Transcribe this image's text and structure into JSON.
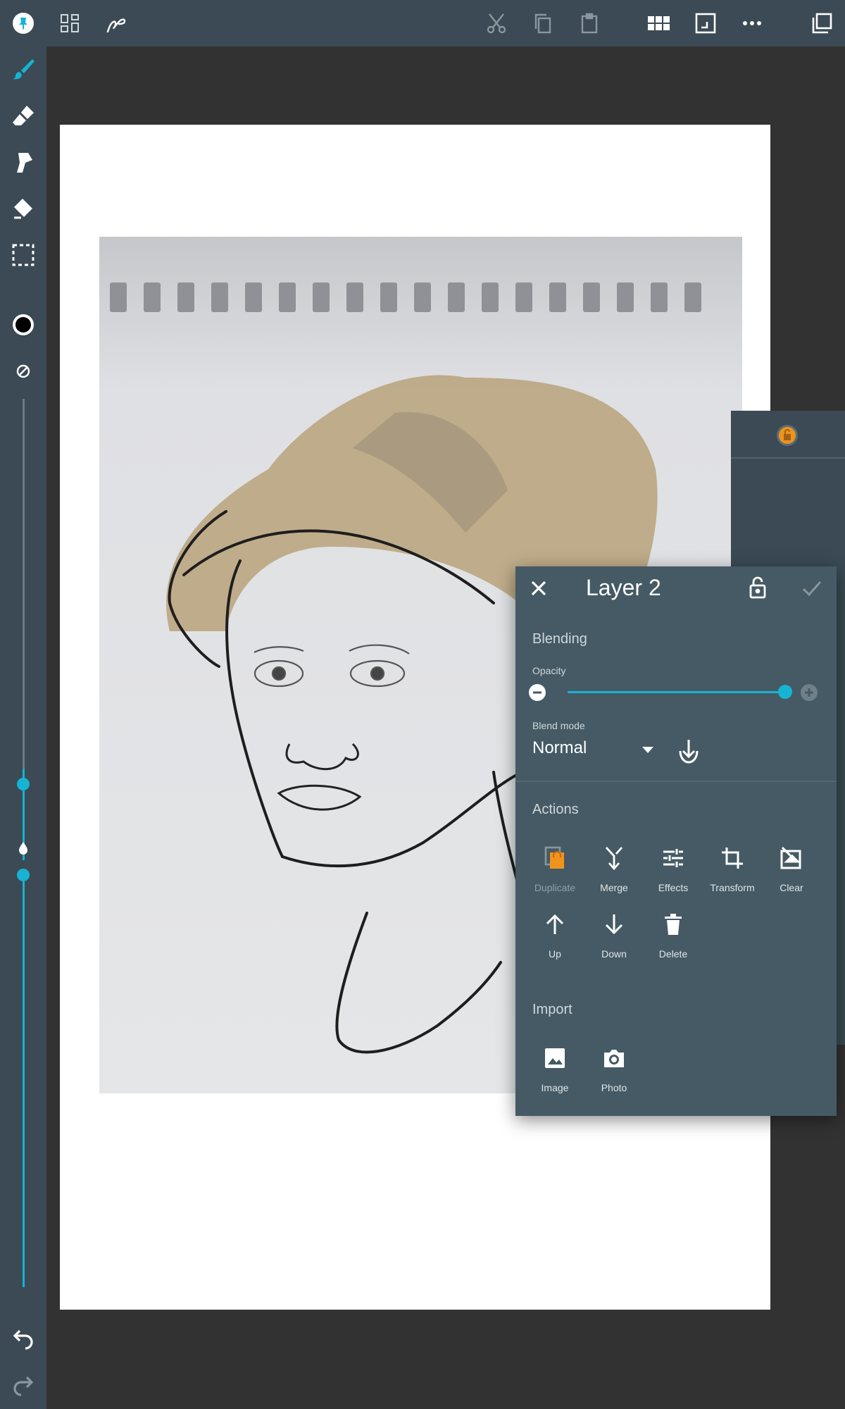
{
  "colors": {
    "accent": "#16b3d3",
    "toolbar_bg": "#3b4a54",
    "dialog_bg": "#455a64",
    "workspace_bg": "#323232",
    "lock_badge": "#f0931d"
  },
  "topbar": {
    "icons": [
      "pin-icon",
      "gallery-icon",
      "stroke-icon",
      "cut-icon",
      "copy-icon",
      "paste-icon",
      "grid-icon",
      "fit-screen-icon",
      "more-icon",
      "layers-icon"
    ]
  },
  "sidebar": {
    "tools": [
      "brush-icon",
      "eraser-icon",
      "smudge-icon",
      "fill-icon",
      "selection-icon",
      "color-icon",
      "no-texture-icon",
      "opacity-drop-icon",
      "undo-icon",
      "redo-icon"
    ],
    "brush_size": 0.28,
    "brush_opacity": 1.0
  },
  "dialog": {
    "title": "Layer 2",
    "blending": {
      "section": "Blending",
      "opacity_label": "Opacity",
      "opacity_value": 1.0,
      "blend_mode_label": "Blend mode",
      "blend_mode_value": "Normal"
    },
    "actions": {
      "section": "Actions",
      "items": [
        {
          "label": "Duplicate",
          "icon": "duplicate-icon",
          "enabled": false
        },
        {
          "label": "Merge",
          "icon": "merge-icon",
          "enabled": true
        },
        {
          "label": "Effects",
          "icon": "effects-icon",
          "enabled": true
        },
        {
          "label": "Transform",
          "icon": "transform-icon",
          "enabled": true
        },
        {
          "label": "Clear",
          "icon": "clear-icon",
          "enabled": true
        },
        {
          "label": "Up",
          "icon": "arrow-up-icon",
          "enabled": true
        },
        {
          "label": "Down",
          "icon": "arrow-down-icon",
          "enabled": true
        },
        {
          "label": "Delete",
          "icon": "delete-icon",
          "enabled": true
        }
      ]
    },
    "import": {
      "section": "Import",
      "items": [
        {
          "label": "Image",
          "icon": "image-icon"
        },
        {
          "label": "Photo",
          "icon": "camera-icon"
        }
      ]
    }
  }
}
